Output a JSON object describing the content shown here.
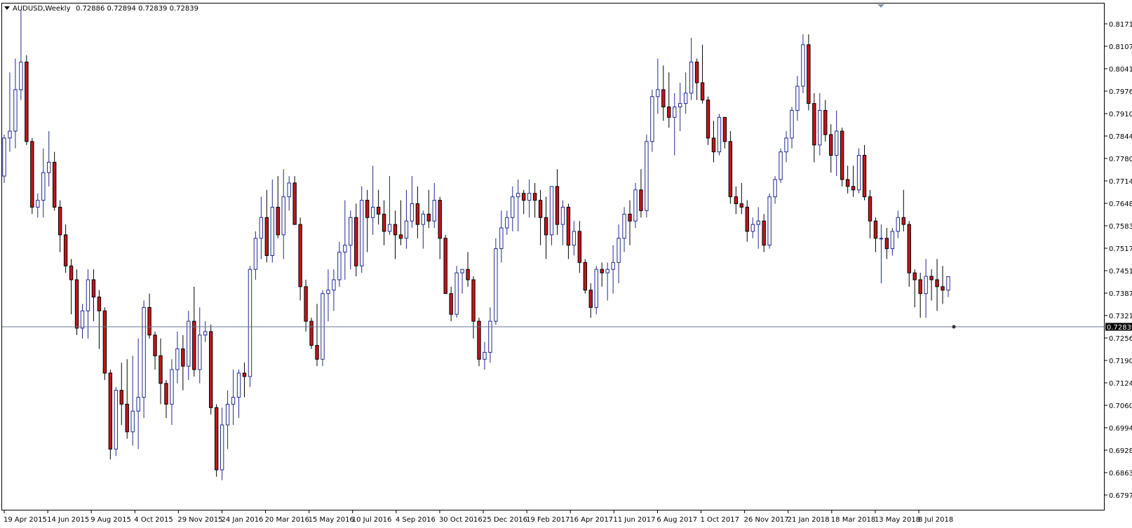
{
  "header": {
    "symbol_label": "AUDUSD,Weekly",
    "ohlc_values": "0.72886 0.72894 0.72839 0.72839"
  },
  "colors": {
    "bull_candle": "#1f2a8f",
    "bear_candle": "#c8141b",
    "bear_body_edge": "#000000",
    "price_line": "#6b7694",
    "axis": "#000000"
  },
  "chart_data": {
    "type": "candlestick",
    "symbol": "AUDUSD",
    "timeframe": "Weekly",
    "current_price": "0.72839",
    "y_ticks": [
      "0.81715",
      "0.81070",
      "0.80410",
      "0.79765",
      "0.79105",
      "0.78445",
      "0.77800",
      "0.77140",
      "0.76480",
      "0.75835",
      "0.75175",
      "0.74515",
      "0.73870",
      "0.73210",
      "0.72565",
      "0.71905",
      "0.71245",
      "0.70600",
      "0.69940",
      "0.69280",
      "0.68635",
      "0.67975"
    ],
    "x_ticks": [
      "19 Apr 2015",
      "14 Jun 2015",
      "9 Aug 2015",
      "4 Oct 2015",
      "29 Nov 2015",
      "24 Jan 2016",
      "20 Mar 2016",
      "15 May 2016",
      "10 Jul 2016",
      "4 Sep 2016",
      "30 Oct 2016",
      "25 Dec 2016",
      "19 Feb 2017",
      "16 Apr 2017",
      "11 Jun 2017",
      "6 Aug 2017",
      "1 Oct 2017",
      "26 Nov 2017",
      "21 Jan 2018",
      "18 Mar 2018",
      "13 May 2018",
      "8 Jul 2018"
    ],
    "ylim": [
      0.6793,
      0.8197
    ],
    "grid": false,
    "candles": [
      [
        0.772,
        0.784,
        0.77,
        0.783
      ],
      [
        0.783,
        0.802,
        0.779,
        0.785
      ],
      [
        0.785,
        0.806,
        0.78,
        0.797
      ],
      [
        0.797,
        0.82,
        0.794,
        0.805
      ],
      [
        0.805,
        0.807,
        0.781,
        0.782
      ],
      [
        0.782,
        0.783,
        0.761,
        0.763
      ],
      [
        0.763,
        0.767,
        0.76,
        0.765
      ],
      [
        0.765,
        0.78,
        0.76,
        0.773
      ],
      [
        0.773,
        0.785,
        0.769,
        0.776
      ],
      [
        0.776,
        0.779,
        0.762,
        0.763
      ],
      [
        0.763,
        0.765,
        0.75,
        0.755
      ],
      [
        0.755,
        0.758,
        0.744,
        0.746
      ],
      [
        0.746,
        0.748,
        0.732,
        0.742
      ],
      [
        0.742,
        0.745,
        0.726,
        0.728
      ],
      [
        0.728,
        0.735,
        0.725,
        0.733
      ],
      [
        0.733,
        0.745,
        0.725,
        0.742
      ],
      [
        0.742,
        0.745,
        0.73,
        0.737
      ],
      [
        0.737,
        0.739,
        0.722,
        0.733
      ],
      [
        0.733,
        0.734,
        0.713,
        0.715
      ],
      [
        0.715,
        0.716,
        0.69,
        0.693
      ],
      [
        0.693,
        0.711,
        0.691,
        0.71
      ],
      [
        0.71,
        0.718,
        0.7,
        0.706
      ],
      [
        0.706,
        0.719,
        0.696,
        0.698
      ],
      [
        0.698,
        0.72,
        0.694,
        0.704
      ],
      [
        0.704,
        0.725,
        0.693,
        0.708
      ],
      [
        0.708,
        0.736,
        0.702,
        0.734
      ],
      [
        0.734,
        0.738,
        0.725,
        0.726
      ],
      [
        0.726,
        0.727,
        0.716,
        0.72
      ],
      [
        0.72,
        0.725,
        0.706,
        0.712
      ],
      [
        0.712,
        0.713,
        0.702,
        0.706
      ],
      [
        0.706,
        0.719,
        0.7,
        0.716
      ],
      [
        0.716,
        0.727,
        0.712,
        0.722
      ],
      [
        0.722,
        0.726,
        0.71,
        0.717
      ],
      [
        0.717,
        0.733,
        0.713,
        0.73
      ],
      [
        0.73,
        0.74,
        0.714,
        0.716
      ],
      [
        0.716,
        0.734,
        0.712,
        0.726
      ],
      [
        0.726,
        0.73,
        0.724,
        0.727
      ],
      [
        0.727,
        0.729,
        0.703,
        0.705
      ],
      [
        0.705,
        0.706,
        0.685,
        0.687
      ],
      [
        0.687,
        0.705,
        0.684,
        0.7
      ],
      [
        0.7,
        0.71,
        0.693,
        0.706
      ],
      [
        0.706,
        0.716,
        0.7,
        0.708
      ],
      [
        0.708,
        0.716,
        0.702,
        0.715
      ],
      [
        0.715,
        0.718,
        0.708,
        0.714
      ],
      [
        0.714,
        0.746,
        0.711,
        0.745
      ],
      [
        0.745,
        0.756,
        0.742,
        0.754
      ],
      [
        0.754,
        0.766,
        0.748,
        0.76
      ],
      [
        0.76,
        0.768,
        0.747,
        0.749
      ],
      [
        0.749,
        0.771,
        0.747,
        0.763
      ],
      [
        0.763,
        0.772,
        0.754,
        0.755
      ],
      [
        0.755,
        0.774,
        0.748,
        0.766
      ],
      [
        0.766,
        0.772,
        0.762,
        0.77
      ],
      [
        0.77,
        0.772,
        0.762,
        0.758
      ],
      [
        0.758,
        0.76,
        0.736,
        0.74
      ],
      [
        0.74,
        0.742,
        0.727,
        0.73
      ],
      [
        0.73,
        0.731,
        0.722,
        0.723
      ],
      [
        0.723,
        0.735,
        0.717,
        0.719
      ],
      [
        0.719,
        0.739,
        0.717,
        0.738
      ],
      [
        0.738,
        0.745,
        0.73,
        0.739
      ],
      [
        0.739,
        0.745,
        0.733,
        0.742
      ],
      [
        0.742,
        0.753,
        0.74,
        0.75
      ],
      [
        0.75,
        0.765,
        0.742,
        0.752
      ],
      [
        0.752,
        0.762,
        0.745,
        0.76
      ],
      [
        0.76,
        0.764,
        0.743,
        0.746
      ],
      [
        0.746,
        0.769,
        0.744,
        0.765
      ],
      [
        0.765,
        0.768,
        0.75,
        0.76
      ],
      [
        0.76,
        0.775,
        0.755,
        0.763
      ],
      [
        0.763,
        0.768,
        0.758,
        0.761
      ],
      [
        0.761,
        0.765,
        0.752,
        0.756
      ],
      [
        0.756,
        0.772,
        0.755,
        0.758
      ],
      [
        0.758,
        0.762,
        0.748,
        0.755
      ],
      [
        0.755,
        0.765,
        0.752,
        0.754
      ],
      [
        0.754,
        0.768,
        0.751,
        0.759
      ],
      [
        0.759,
        0.772,
        0.757,
        0.764
      ],
      [
        0.764,
        0.769,
        0.754,
        0.758
      ],
      [
        0.758,
        0.762,
        0.751,
        0.761
      ],
      [
        0.761,
        0.768,
        0.757,
        0.759
      ],
      [
        0.759,
        0.77,
        0.757,
        0.765
      ],
      [
        0.765,
        0.766,
        0.748,
        0.754
      ],
      [
        0.754,
        0.755,
        0.74,
        0.738
      ],
      [
        0.738,
        0.74,
        0.73,
        0.732
      ],
      [
        0.732,
        0.746,
        0.731,
        0.744
      ],
      [
        0.744,
        0.745,
        0.738,
        0.745
      ],
      [
        0.745,
        0.75,
        0.74,
        0.742
      ],
      [
        0.742,
        0.743,
        0.725,
        0.73
      ],
      [
        0.73,
        0.731,
        0.717,
        0.719
      ],
      [
        0.719,
        0.724,
        0.716,
        0.721
      ],
      [
        0.721,
        0.734,
        0.718,
        0.73
      ],
      [
        0.73,
        0.754,
        0.729,
        0.751
      ],
      [
        0.751,
        0.762,
        0.747,
        0.757
      ],
      [
        0.757,
        0.762,
        0.755,
        0.76
      ],
      [
        0.76,
        0.769,
        0.756,
        0.766
      ],
      [
        0.766,
        0.771,
        0.756,
        0.767
      ],
      [
        0.767,
        0.768,
        0.761,
        0.765
      ],
      [
        0.765,
        0.771,
        0.76,
        0.767
      ],
      [
        0.767,
        0.77,
        0.76,
        0.765
      ],
      [
        0.765,
        0.768,
        0.752,
        0.76
      ],
      [
        0.76,
        0.766,
        0.748,
        0.755
      ],
      [
        0.755,
        0.769,
        0.752,
        0.769
      ],
      [
        0.769,
        0.774,
        0.755,
        0.758
      ],
      [
        0.758,
        0.765,
        0.752,
        0.763
      ],
      [
        0.763,
        0.764,
        0.748,
        0.752
      ],
      [
        0.752,
        0.759,
        0.749,
        0.756
      ],
      [
        0.756,
        0.759,
        0.744,
        0.747
      ],
      [
        0.747,
        0.748,
        0.738,
        0.739
      ],
      [
        0.739,
        0.741,
        0.731,
        0.734
      ],
      [
        0.734,
        0.746,
        0.732,
        0.745
      ],
      [
        0.745,
        0.747,
        0.74,
        0.744
      ],
      [
        0.744,
        0.747,
        0.736,
        0.745
      ],
      [
        0.745,
        0.752,
        0.738,
        0.747
      ],
      [
        0.747,
        0.758,
        0.741,
        0.754
      ],
      [
        0.754,
        0.763,
        0.75,
        0.761
      ],
      [
        0.761,
        0.765,
        0.752,
        0.759
      ],
      [
        0.759,
        0.77,
        0.757,
        0.768
      ],
      [
        0.768,
        0.774,
        0.76,
        0.762
      ],
      [
        0.762,
        0.784,
        0.76,
        0.782
      ],
      [
        0.782,
        0.797,
        0.779,
        0.795
      ],
      [
        0.795,
        0.806,
        0.79,
        0.797
      ],
      [
        0.797,
        0.804,
        0.788,
        0.792
      ],
      [
        0.792,
        0.802,
        0.786,
        0.789
      ],
      [
        0.789,
        0.796,
        0.778,
        0.792
      ],
      [
        0.792,
        0.799,
        0.785,
        0.793
      ],
      [
        0.793,
        0.802,
        0.79,
        0.796
      ],
      [
        0.796,
        0.812,
        0.794,
        0.805
      ],
      [
        0.805,
        0.806,
        0.794,
        0.799
      ],
      [
        0.799,
        0.81,
        0.793,
        0.794
      ],
      [
        0.794,
        0.795,
        0.781,
        0.783
      ],
      [
        0.783,
        0.788,
        0.776,
        0.779
      ],
      [
        0.779,
        0.79,
        0.778,
        0.789
      ],
      [
        0.789,
        0.789,
        0.78,
        0.782
      ],
      [
        0.782,
        0.785,
        0.764,
        0.766
      ],
      [
        0.766,
        0.769,
        0.761,
        0.764
      ],
      [
        0.764,
        0.77,
        0.761,
        0.763
      ],
      [
        0.763,
        0.765,
        0.753,
        0.756
      ],
      [
        0.756,
        0.76,
        0.754,
        0.758
      ],
      [
        0.758,
        0.763,
        0.751,
        0.759
      ],
      [
        0.759,
        0.761,
        0.75,
        0.752
      ],
      [
        0.752,
        0.767,
        0.751,
        0.766
      ],
      [
        0.766,
        0.772,
        0.764,
        0.771
      ],
      [
        0.771,
        0.78,
        0.77,
        0.779
      ],
      [
        0.779,
        0.785,
        0.776,
        0.783
      ],
      [
        0.783,
        0.792,
        0.78,
        0.791
      ],
      [
        0.791,
        0.801,
        0.788,
        0.798
      ],
      [
        0.798,
        0.813,
        0.796,
        0.81
      ],
      [
        0.81,
        0.813,
        0.791,
        0.793
      ],
      [
        0.793,
        0.796,
        0.776,
        0.781
      ],
      [
        0.781,
        0.796,
        0.778,
        0.791
      ],
      [
        0.791,
        0.794,
        0.782,
        0.784
      ],
      [
        0.784,
        0.787,
        0.773,
        0.778
      ],
      [
        0.778,
        0.791,
        0.772,
        0.785
      ],
      [
        0.785,
        0.786,
        0.769,
        0.771
      ],
      [
        0.771,
        0.775,
        0.767,
        0.769
      ],
      [
        0.769,
        0.775,
        0.766,
        0.768
      ],
      [
        0.768,
        0.78,
        0.767,
        0.778
      ],
      [
        0.778,
        0.781,
        0.765,
        0.766
      ],
      [
        0.766,
        0.768,
        0.754,
        0.759
      ],
      [
        0.759,
        0.76,
        0.75,
        0.754
      ],
      [
        0.754,
        0.758,
        0.741,
        0.754
      ],
      [
        0.754,
        0.757,
        0.748,
        0.751
      ],
      [
        0.751,
        0.757,
        0.749,
        0.756
      ],
      [
        0.756,
        0.762,
        0.754,
        0.76
      ],
      [
        0.76,
        0.768,
        0.756,
        0.758
      ],
      [
        0.758,
        0.759,
        0.74,
        0.744
      ],
      [
        0.744,
        0.745,
        0.734,
        0.742
      ],
      [
        0.742,
        0.744,
        0.731,
        0.738
      ],
      [
        0.738,
        0.748,
        0.731,
        0.743
      ],
      [
        0.743,
        0.745,
        0.736,
        0.742
      ],
      [
        0.742,
        0.748,
        0.733,
        0.74
      ],
      [
        0.74,
        0.746,
        0.735,
        0.739
      ],
      [
        0.739,
        0.743,
        0.737,
        0.7429
      ]
    ]
  }
}
